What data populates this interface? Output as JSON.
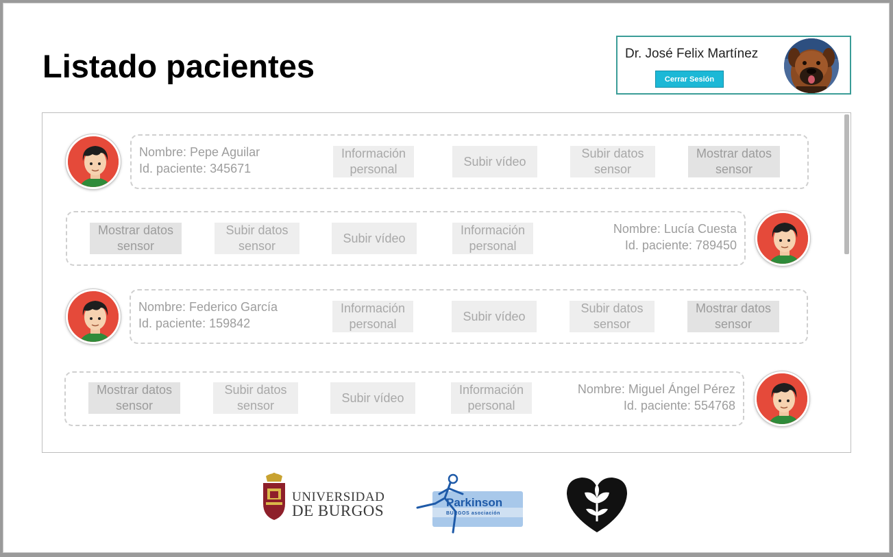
{
  "page": {
    "title": "Listado pacientes"
  },
  "user": {
    "name": "Dr. José Felix Martínez",
    "logout_label": "Cerrar Sesión"
  },
  "actions": {
    "personal_info": "Información personal",
    "upload_video": "Subir vídeo",
    "upload_sensor": "Subir datos sensor",
    "show_sensor": "Mostrar datos sensor"
  },
  "patients": [
    {
      "name_line": "Nombre: Pepe Aguilar",
      "id_line": "Id. paciente: 345671"
    },
    {
      "name_line": "Nombre: Lucía Cuesta",
      "id_line": "Id. paciente: 789450"
    },
    {
      "name_line": "Nombre: Federico García",
      "id_line": "Id. paciente: 159842"
    },
    {
      "name_line": "Nombre: Miguel Ángel Pérez",
      "id_line": "Id. paciente: 554768"
    }
  ],
  "footer": {
    "ubu_line1": "UNIVERSIDAD",
    "ubu_line2": "DE BURGOS",
    "parkinson_name": "Parkinson",
    "parkinson_sub": "BURGOS asociación"
  },
  "colors": {
    "accent": "#1cb8d6",
    "user_box_border": "#3a9c97",
    "avatar_bg": "#e54a3a",
    "button_bg": "#eeeeee",
    "button_text": "#a8a8a8"
  },
  "icons": [
    "doctor-avatar",
    "patient-avatar-icon",
    "universidad-burgos-logo",
    "parkinson-burgos-logo",
    "heart-flower-logo"
  ]
}
